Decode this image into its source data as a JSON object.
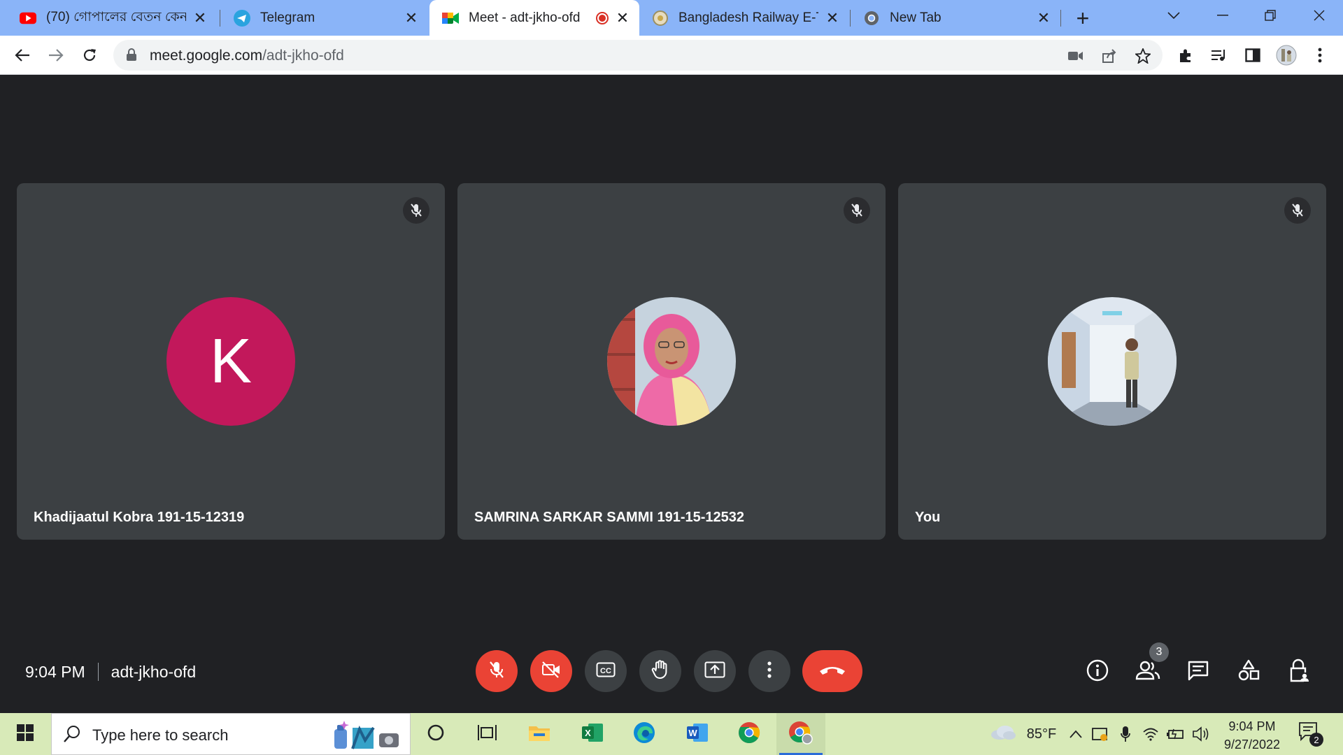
{
  "browser": {
    "tabs": [
      {
        "title": "(70) গোপালের বেতন কেন",
        "icon": "youtube-icon"
      },
      {
        "title": "Telegram",
        "icon": "telegram-icon"
      },
      {
        "title": "Meet - adt-jkho-ofd",
        "icon": "google-meet-icon",
        "recording": true
      },
      {
        "title": "Bangladesh Railway E-Ticl",
        "icon": "railway-icon"
      },
      {
        "title": "New Tab",
        "icon": "chrome-icon"
      }
    ],
    "url_host": "meet.google.com",
    "url_path": "/adt-jkho-ofd"
  },
  "meet": {
    "participants": [
      {
        "name": "Khadijaatul Kobra 191-15-12319",
        "initial": "K",
        "muted": true
      },
      {
        "name": "SAMRINA SARKAR SAMMI 191-15-12532",
        "muted": true
      },
      {
        "name": "You",
        "muted": true
      }
    ],
    "time": "9:04 PM",
    "meeting_code": "adt-jkho-ofd",
    "participant_count": "3",
    "colors": {
      "end_call": "#ea4335",
      "tile_bg": "#3c4043",
      "avatar_k": "#c2185b"
    }
  },
  "taskbar": {
    "search_placeholder": "Type here to search",
    "weather": "85°F",
    "clock_time": "9:04 PM",
    "clock_date": "9/27/2022",
    "notification_count": "2"
  }
}
